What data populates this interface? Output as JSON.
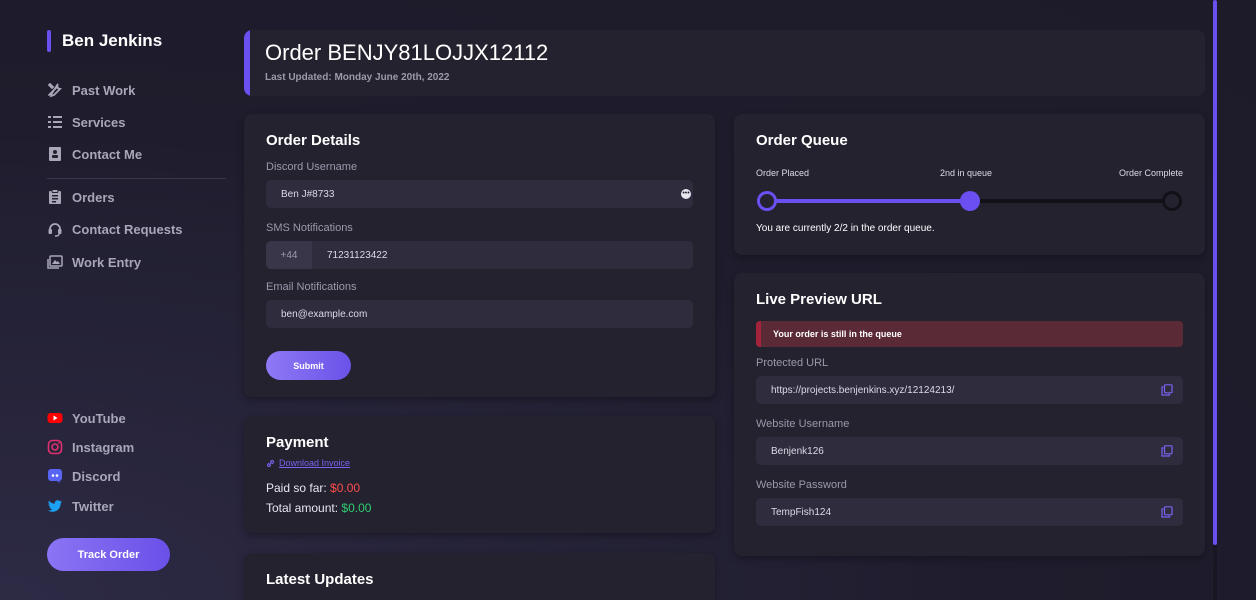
{
  "sidebar": {
    "brand": "Ben Jenkins",
    "nav": [
      {
        "label": "Past Work",
        "icon": "tools-icon"
      },
      {
        "label": "Services",
        "icon": "list-icon"
      },
      {
        "label": "Contact Me",
        "icon": "contact-card-icon"
      },
      {
        "label": "Orders",
        "icon": "clipboard-icon"
      },
      {
        "label": "Contact Requests",
        "icon": "headset-icon"
      },
      {
        "label": "Work Entry",
        "icon": "images-icon"
      }
    ],
    "social": [
      {
        "label": "YouTube",
        "icon": "youtube-icon",
        "color": "#ff0000"
      },
      {
        "label": "Instagram",
        "icon": "instagram-icon",
        "color": "#e1306c"
      },
      {
        "label": "Discord",
        "icon": "discord-icon",
        "color": "#5865f2"
      },
      {
        "label": "Twitter",
        "icon": "twitter-icon",
        "color": "#1da1f2"
      }
    ],
    "track_order": "Track Order"
  },
  "header": {
    "title": "Order BENJY81LOJJX12112",
    "subtitle": "Last Updated: Monday June 20th, 2022"
  },
  "order_details": {
    "title": "Order Details",
    "discord_label": "Discord Username",
    "discord_value": "Ben J#8733",
    "sms_label": "SMS Notifications",
    "sms_prefix": "+44",
    "sms_value": "71231123422",
    "email_label": "Email Notifications",
    "email_value": "ben@example.com",
    "submit": "Submit"
  },
  "payment": {
    "title": "Payment",
    "invoice_link": "Download Invoice",
    "paid_label": "Paid so far:",
    "paid_value": "$0.00",
    "total_label": "Total amount:",
    "total_value": "$0.00"
  },
  "latest_updates": {
    "title": "Latest Updates"
  },
  "order_queue": {
    "title": "Order Queue",
    "step_placed": "Order Placed",
    "step_current": "2nd in queue",
    "step_complete": "Order Complete",
    "progress": 0.5,
    "status_text": "You are currently 2/2 in the order queue."
  },
  "live_preview": {
    "title": "Live Preview URL",
    "alert": "Your order is still in the queue",
    "url_label": "Protected URL",
    "url_value": "https://projects.benjenkins.xyz/12124213/",
    "username_label": "Website Username",
    "username_value": "Benjenk126",
    "password_label": "Website Password",
    "password_value": "TempFish124"
  },
  "colors": {
    "accent": "#6c4ff0",
    "paid": "#ff4d4d",
    "total": "#2ecc71",
    "alert_bg": "#5b2a37"
  }
}
